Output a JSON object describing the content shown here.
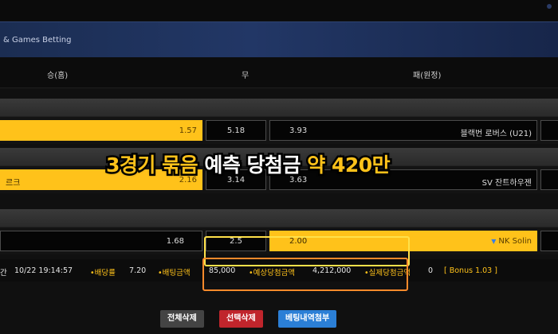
{
  "header": {
    "title": "& Games Betting"
  },
  "columns": {
    "home": "승(홈)",
    "draw": "무",
    "away": "패(원정)"
  },
  "matches": [
    {
      "home_name": "",
      "home_odds": "1.57",
      "draw_odds": "5.18",
      "away_odds": "3.93",
      "away_name": "블랙번 로버스 (U21)"
    },
    {
      "home_name": "르크",
      "home_odds": "2.16",
      "draw_odds": "3.14",
      "away_odds": "3.63",
      "away_name": "SV 잔트하우젠"
    },
    {
      "home_name": "",
      "home_odds": "1.68",
      "draw_odds": "2.5",
      "away_odds": "2.00",
      "away_name": "NK Solin"
    }
  ],
  "slip": {
    "prefix": "간",
    "time": "10/22 19:14:57",
    "rate_label": "•배당률",
    "rate_value": "7.20",
    "amount_label": "•배팅금액",
    "amount_value": "85,000",
    "expected_label": "•예상당첨금액",
    "expected_value": "4,212,000",
    "actual_label": "•실제당첨금액",
    "actual_value": "0",
    "bonus": "[ Bonus 1.03 ]"
  },
  "buttons": {
    "delete_all": "전체삭제",
    "delete_selected": "선택삭제",
    "attach_history": "베팅내역첨부"
  },
  "banner": {
    "part1": "3경기 묶음",
    "part2": " 예측 당첨금 ",
    "part3": "약 420만"
  },
  "colors": {
    "accent": "#ffc21a",
    "delete_all": "#444444",
    "delete_selected": "#c0252c",
    "attach": "#2b7fd6"
  },
  "icons": {
    "away_pick": "triangle-down-icon"
  }
}
